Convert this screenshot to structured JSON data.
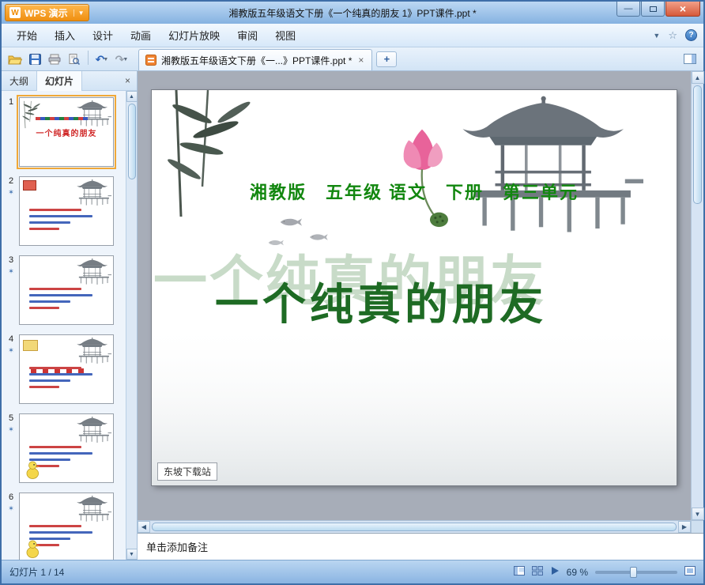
{
  "window": {
    "app_button_label": "WPS 演示",
    "title": "湘教版五年级语文下册《一个纯真的朋友 1》PPT课件.ppt *"
  },
  "menu": {
    "items": [
      {
        "label": "开始"
      },
      {
        "label": "插入"
      },
      {
        "label": "设计"
      },
      {
        "label": "动画"
      },
      {
        "label": "幻灯片放映"
      },
      {
        "label": "审阅"
      },
      {
        "label": "视图"
      }
    ]
  },
  "toolbar": {
    "doc_tab_label": "湘教版五年级语文下册《一...》PPT课件.ppt *",
    "new_tab_label": "+"
  },
  "sidebar": {
    "tabs": [
      {
        "label": "大纲"
      },
      {
        "label": "幻灯片"
      }
    ],
    "thumb_title": "一个纯真的朋友",
    "slides": [
      {
        "num": "1",
        "variant": 1,
        "selected": true,
        "animation": false
      },
      {
        "num": "2",
        "variant": 2,
        "selected": false,
        "animation": true
      },
      {
        "num": "3",
        "variant": 3,
        "selected": false,
        "animation": true
      },
      {
        "num": "4",
        "variant": 4,
        "selected": false,
        "animation": true
      },
      {
        "num": "5",
        "variant": 5,
        "selected": false,
        "animation": true
      },
      {
        "num": "6",
        "variant": 6,
        "selected": false,
        "animation": true
      }
    ]
  },
  "slide": {
    "header": "湘教版　五年级 语文　下册　第三单元",
    "watermark": "一个纯真的朋友",
    "title": "一个纯真的朋友",
    "site_label": "东坡下载站"
  },
  "notes": {
    "placeholder": "单击添加备注"
  },
  "status": {
    "slide_counter": "幻灯片 1 / 14",
    "zoom": "69 %"
  },
  "colors": {
    "accent_orange": "#f59b22",
    "header_green": "#12870f",
    "title_green": "#1e6b24",
    "close_red": "#d6593a"
  }
}
